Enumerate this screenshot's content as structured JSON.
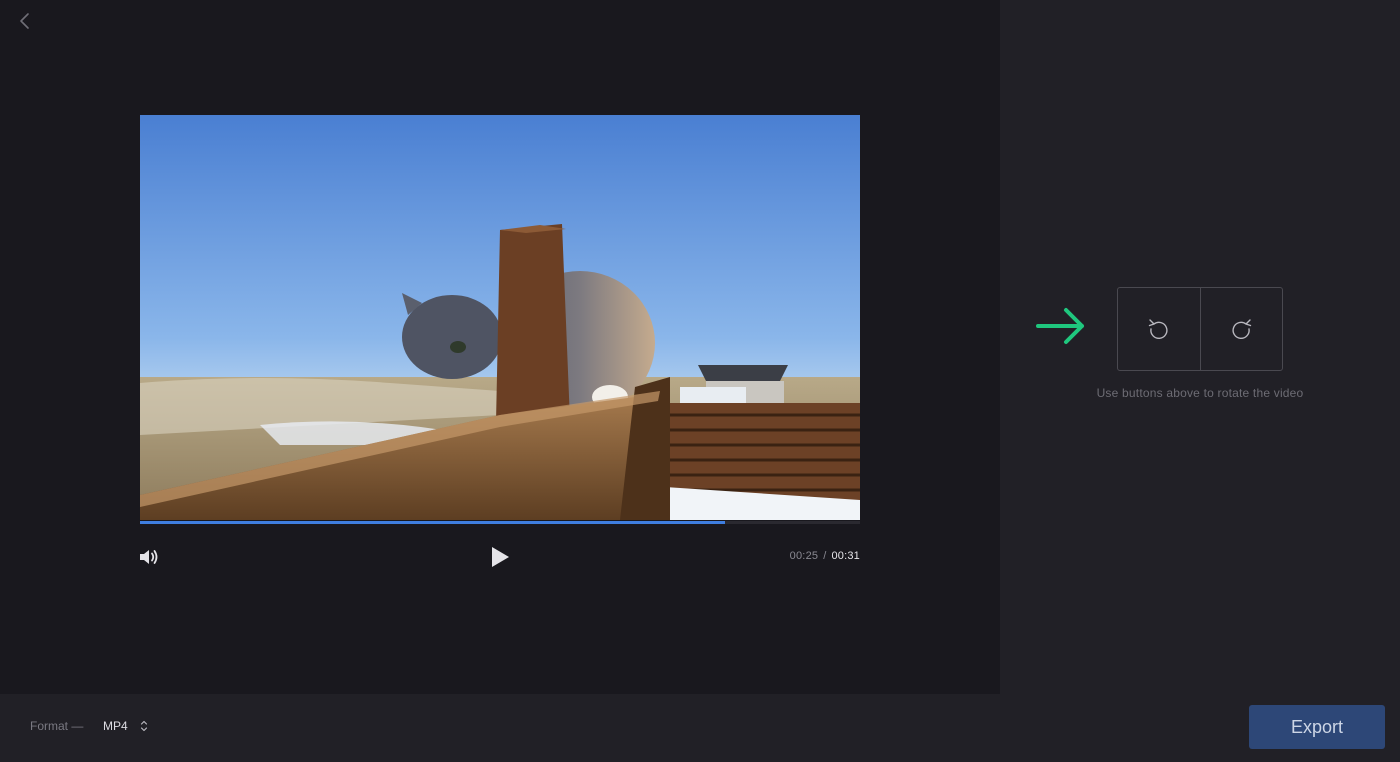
{
  "player": {
    "progress_fraction": 0.812,
    "current_time": "00:25",
    "separator": "/",
    "total_time": "00:31"
  },
  "rotate": {
    "hint": "Use buttons above to rotate the video"
  },
  "format": {
    "label": "Format —",
    "value": "MP4"
  },
  "export": {
    "label": "Export"
  },
  "icons": {
    "back": "chevron-left-icon",
    "volume": "volume-icon",
    "play": "play-icon",
    "rotate_left": "rotate-counterclockwise-icon",
    "rotate_right": "rotate-clockwise-icon",
    "arrow": "arrow-right-icon",
    "select": "chevron-up-down-icon"
  },
  "colors": {
    "accent": "#3f7ee0",
    "arrow": "#1fc77e",
    "export_button": "#2d4777"
  }
}
